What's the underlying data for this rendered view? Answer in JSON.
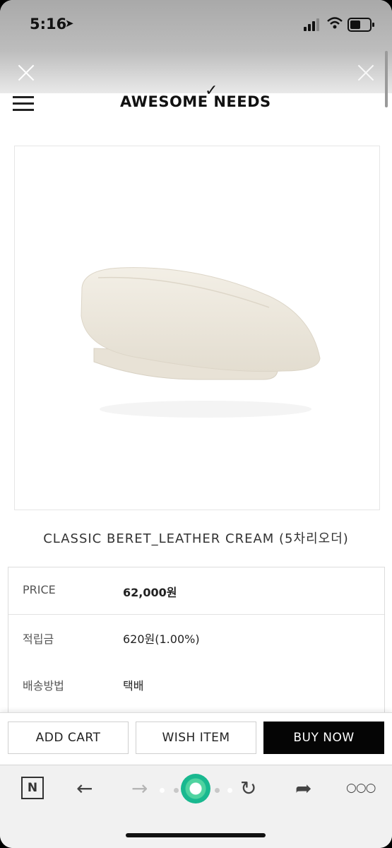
{
  "status_bar": {
    "time": "5:16",
    "location_glyph": "➤"
  },
  "site": {
    "logo_text": "AWESOME NEEDS",
    "logo_mark": "✓"
  },
  "product": {
    "title": "CLASSIC BERET_LEATHER CREAM (5차리오더)",
    "image_color": "#ece7dc"
  },
  "info": {
    "rows": [
      {
        "label": "PRICE",
        "value": "62,000원"
      },
      {
        "label": "적립금",
        "value": "620원(1.00%)"
      },
      {
        "label": "배송방법",
        "value": "택배"
      }
    ]
  },
  "actions": {
    "add_cart": "ADD CART",
    "wish_item": "WISH ITEM",
    "buy_now": "BUY NOW"
  },
  "toolbar": {
    "naver_label": "N",
    "back_icon": "←",
    "forward_icon": "→",
    "refresh_icon": "↻",
    "share_icon": "➦",
    "more_icon": "○○○"
  }
}
